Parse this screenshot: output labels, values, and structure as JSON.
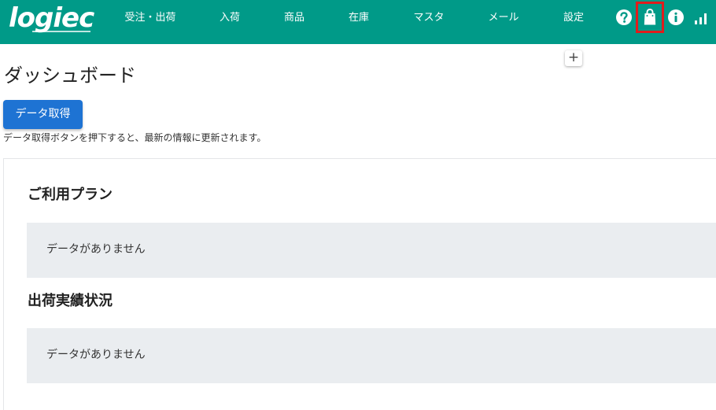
{
  "header": {
    "logo_text": "logiec",
    "nav": [
      {
        "label": "受注・出荷"
      },
      {
        "label": "入荷"
      },
      {
        "label": "商品"
      },
      {
        "label": "在庫"
      },
      {
        "label": "マスタ"
      },
      {
        "label": "メール"
      },
      {
        "label": "設定"
      }
    ],
    "icons": [
      "help-icon",
      "shopping-bag-icon",
      "info-icon",
      "signal-bars-icon"
    ],
    "highlighted_icon": "shopping-bag-icon",
    "colors": {
      "header_bg": "#009a88",
      "highlight_border": "#e01c1c"
    }
  },
  "page": {
    "add_button_label": "+",
    "title": "ダッシュボード",
    "fetch_button_label": "データ取得",
    "help_text": "データ取得ボタンを押下すると、最新の情報に更新されます。",
    "colors": {
      "primary_button": "#1e73d3",
      "empty_panel_bg": "#eaedf0"
    }
  },
  "sections": [
    {
      "title": "ご利用プラン",
      "empty_message": "データがありません"
    },
    {
      "title": "出荷実績状況",
      "empty_message": "データがありません"
    }
  ]
}
